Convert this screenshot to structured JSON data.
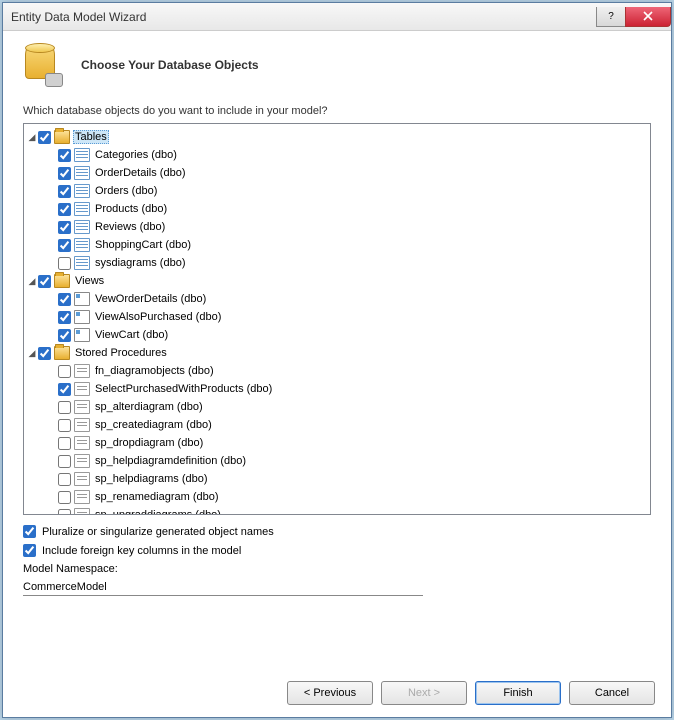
{
  "window": {
    "title": "Entity Data Model Wizard"
  },
  "header": {
    "title": "Choose Your Database Objects"
  },
  "prompt": "Which database objects do you want to include in your model?",
  "tree": {
    "tables": {
      "label": "Tables",
      "items": [
        {
          "label": "Categories (dbo)",
          "checked": true
        },
        {
          "label": "OrderDetails (dbo)",
          "checked": true
        },
        {
          "label": "Orders (dbo)",
          "checked": true
        },
        {
          "label": "Products (dbo)",
          "checked": true
        },
        {
          "label": "Reviews (dbo)",
          "checked": true
        },
        {
          "label": "ShoppingCart (dbo)",
          "checked": true
        },
        {
          "label": "sysdiagrams (dbo)",
          "checked": false
        }
      ]
    },
    "views": {
      "label": "Views",
      "items": [
        {
          "label": "VewOrderDetails (dbo)",
          "checked": true
        },
        {
          "label": "ViewAlsoPurchased (dbo)",
          "checked": true
        },
        {
          "label": "ViewCart (dbo)",
          "checked": true
        }
      ]
    },
    "sprocs": {
      "label": "Stored Procedures",
      "items": [
        {
          "label": "fn_diagramobjects (dbo)",
          "checked": false
        },
        {
          "label": "SelectPurchasedWithProducts (dbo)",
          "checked": true
        },
        {
          "label": "sp_alterdiagram (dbo)",
          "checked": false
        },
        {
          "label": "sp_creatediagram (dbo)",
          "checked": false
        },
        {
          "label": "sp_dropdiagram (dbo)",
          "checked": false
        },
        {
          "label": "sp_helpdiagramdefinition (dbo)",
          "checked": false
        },
        {
          "label": "sp_helpdiagrams (dbo)",
          "checked": false
        },
        {
          "label": "sp_renamediagram (dbo)",
          "checked": false
        },
        {
          "label": "sp_upgraddiagrams (dbo)",
          "checked": false
        }
      ]
    }
  },
  "options": {
    "pluralize": {
      "label": "Pluralize or singularize generated object names",
      "checked": true
    },
    "fk": {
      "label": "Include foreign key columns in the model",
      "checked": true
    }
  },
  "namespace": {
    "label": "Model Namespace:",
    "value": "CommerceModel"
  },
  "buttons": {
    "previous": "< Previous",
    "next": "Next >",
    "finish": "Finish",
    "cancel": "Cancel"
  }
}
